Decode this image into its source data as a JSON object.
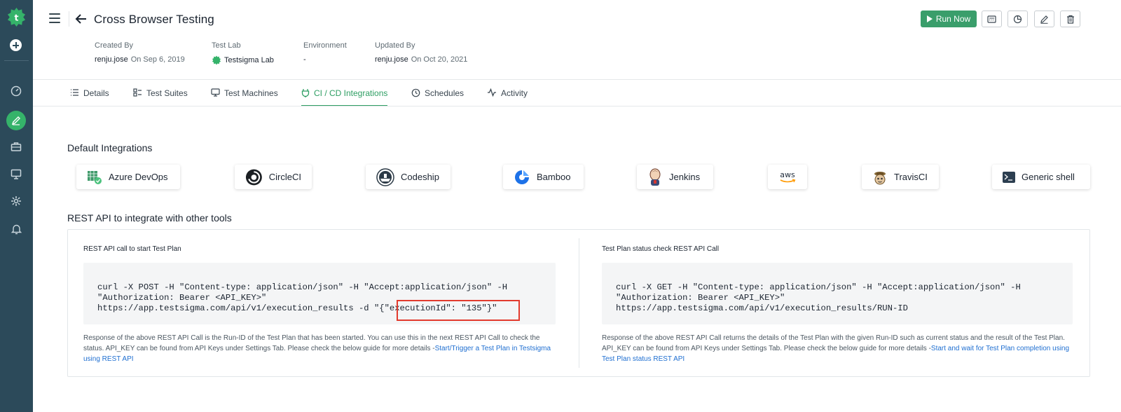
{
  "header": {
    "title": "Cross Browser Testing",
    "run_label": "Run Now"
  },
  "meta": {
    "created_by": {
      "label": "Created By",
      "user": "renju.jose",
      "date": "On Sep 6, 2019"
    },
    "test_lab": {
      "label": "Test Lab",
      "value": "Testsigma Lab"
    },
    "environment": {
      "label": "Environment",
      "value": "-"
    },
    "updated_by": {
      "label": "Updated By",
      "user": "renju.jose",
      "date": "On Oct 20, 2021"
    }
  },
  "tabs": [
    {
      "label": "Details",
      "icon": "list-icon",
      "active": false
    },
    {
      "label": "Test Suites",
      "icon": "suites-icon",
      "active": false
    },
    {
      "label": "Test Machines",
      "icon": "monitor-icon",
      "active": false
    },
    {
      "label": "CI / CD Integrations",
      "icon": "plug-icon",
      "active": true
    },
    {
      "label": "Schedules",
      "icon": "clock-icon",
      "active": false
    },
    {
      "label": "Activity",
      "icon": "activity-icon",
      "active": false
    }
  ],
  "integrations": {
    "title": "Default Integrations",
    "items": [
      "Azure DevOps",
      "CircleCI",
      "Codeship",
      "Bamboo",
      "Jenkins",
      "aws",
      "TravisCI",
      "Generic shell"
    ]
  },
  "rest": {
    "title": "REST API to integrate with other tools",
    "start": {
      "heading": "REST API call to start Test Plan",
      "code_line1": "curl -X POST -H \"Content-type: application/json\" -H \"Accept:application/json\" -H",
      "code_line2": "\"Authorization: Bearer <API_KEY>\"",
      "code_line3": "https://app.testsigma.com/api/v1/execution_results -d \"{\"executionId\": \"135\"}\"",
      "note": "Response of the above REST API Call is the Run-ID of the Test Plan that has been started. You can use this in the next REST API Call to check the status. API_KEY can be found from API Keys under Settings Tab. Please check the below guide for more details -",
      "link": "Start/Trigger a Test Plan in Testsigma using REST API"
    },
    "status": {
      "heading": "Test Plan status check REST API Call",
      "code_line1": "curl -X GET -H \"Content-type: application/json\" -H \"Accept:application/json\" -H",
      "code_line2": "\"Authorization: Bearer <API_KEY>\"",
      "code_line3": "https://app.testsigma.com/api/v1/execution_results/RUN-ID",
      "note": "Response of the above REST API Call returns the details of the Test Plan with the given Run-ID such as current status and the result of the Test Plan. API_KEY can be found from API Keys under Settings Tab. Please check the below guide for more details -",
      "link": "Start and wait for Test Plan completion using Test Plan status REST API"
    }
  },
  "colors": {
    "sidebar": "#2c4a5a",
    "accent": "#35b36a",
    "run_button": "#3a9e6b",
    "highlight": "#e23b2e",
    "link": "#1f6fd1"
  }
}
